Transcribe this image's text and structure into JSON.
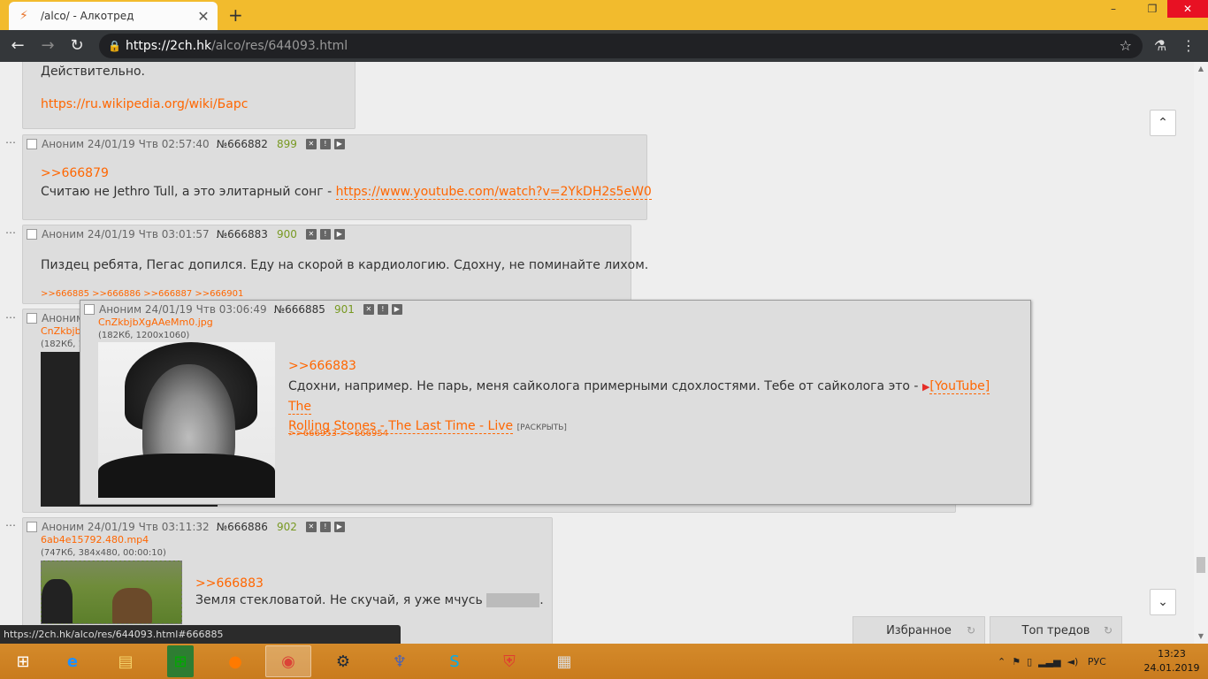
{
  "browser": {
    "tab_title": "/alco/ - Алкотред",
    "tab_close": "✕",
    "new_tab": "+",
    "url_host": "https://2ch.hk",
    "url_path": "/alco/res/644093.html",
    "window_minimize": "–",
    "window_restore": "❐",
    "window_close": "✕"
  },
  "posts": {
    "top_fragment": {
      "line1": "Действительно.",
      "link": "https://ru.wikipedia.org/wiki/Барс"
    },
    "p882": {
      "author": "Аноним",
      "date": "24/01/19 Чтв 02:57:40",
      "num": "№666882",
      "count": "899",
      "quote": ">>666879",
      "text": "Считаю не Jethro Tull, а это элитарный сонг - ",
      "link": "https://www.youtube.com/watch?v=2YkDH2s5eW0"
    },
    "p883": {
      "author": "Аноним",
      "date": "24/01/19 Чтв 03:01:57",
      "num": "№666883",
      "count": "900",
      "text": "Пиздец ребята, Пегас допился. Еду на скорой в кардиологию. Сдохну, не поминайте лихом.",
      "reply1": ">>666885",
      "reply2": ">>666886",
      "reply3": ">>666887",
      "reply4": ">>666901"
    },
    "p885_hidden": {
      "author": "Аноним",
      "file": "CnZkbjb",
      "info": "(182Кб, 1"
    },
    "p886": {
      "author": "Аноним",
      "date": "24/01/19 Чтв 03:11:32",
      "num": "№666886",
      "count": "902",
      "file": "6ab4e15792.480.mp4",
      "info": "(747Кб, 384x480, 00:00:10)",
      "quote": ">>666883",
      "text": "Земля стекловатой. Не скучай, я уже мчусь ",
      "after_spoiler": "."
    }
  },
  "popup": {
    "author": "Аноним",
    "date": "24/01/19 Чтв 03:06:49",
    "num": "№666885",
    "count": "901",
    "file": "CnZkbjbXgAAeMm0.jpg",
    "info": "(182Кб, 1200x1060)",
    "quote": ">>666883",
    "text": "Сдохни, например. Не парь, меня сайколога примерными сдохлостями. Тебе от сайколога это - ",
    "yt_link_line1": "[YouTube] The",
    "yt_link_line2": "Rolling Stones - The Last Time - Live",
    "expand": "[РАСКРЫТЬ]",
    "reply1": ">>666953",
    "reply2": ">>666954"
  },
  "bottom": {
    "favorites": "Избранное",
    "top_threads": "Топ тредов"
  },
  "statusbar": "https://2ch.hk/alco/res/644093.html#666885",
  "taskbar": {
    "lang": "РУС",
    "time": "13:23",
    "date": "24.01.2019"
  }
}
